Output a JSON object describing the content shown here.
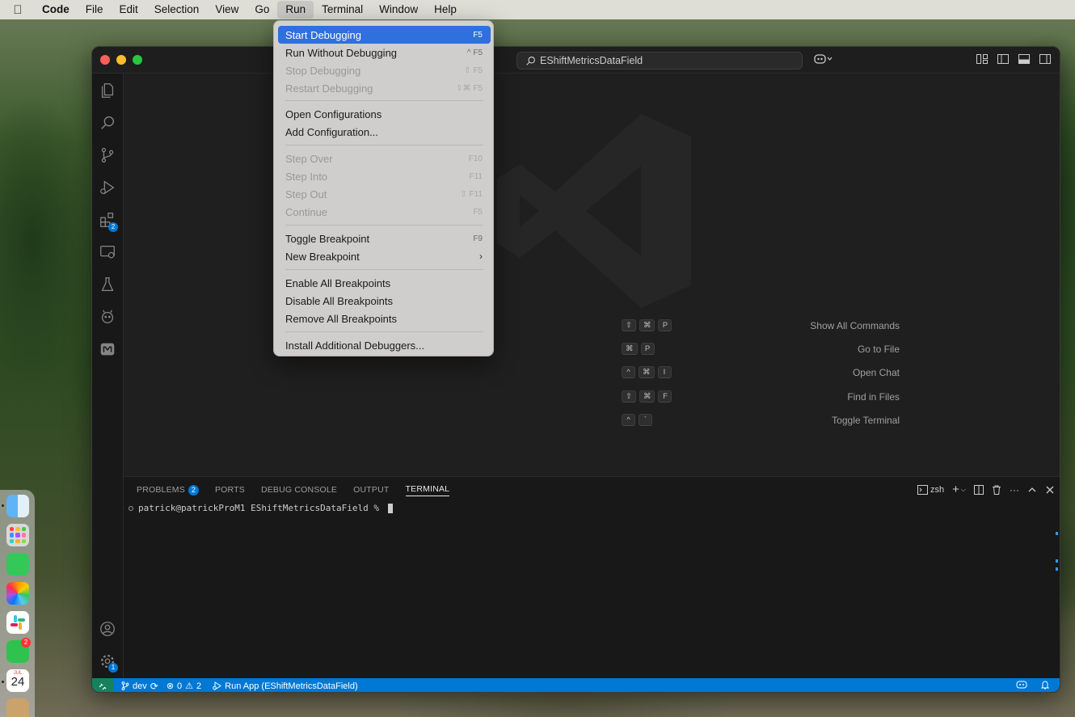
{
  "menubar": {
    "app": "Code",
    "items": [
      "File",
      "Edit",
      "Selection",
      "View",
      "Go",
      "Run",
      "Terminal",
      "Window",
      "Help"
    ],
    "active": "Run"
  },
  "window": {
    "search_text": "EShiftMetricsDataField"
  },
  "activity_bar": {
    "extensions_badge": "2",
    "settings_badge": "1"
  },
  "welcome": {
    "shortcuts": [
      {
        "label": "Show All Commands",
        "keys": [
          "⇧",
          "⌘",
          "P"
        ]
      },
      {
        "label": "Go to File",
        "keys": [
          "⌘",
          "P"
        ]
      },
      {
        "label": "Open Chat",
        "keys": [
          "^",
          "⌘",
          "I"
        ]
      },
      {
        "label": "Find in Files",
        "keys": [
          "⇧",
          "⌘",
          "F"
        ]
      },
      {
        "label": "Toggle Terminal",
        "keys": [
          "^",
          "`"
        ]
      }
    ]
  },
  "panel": {
    "tabs": [
      {
        "label": "PROBLEMS",
        "badge": "2"
      },
      {
        "label": "PORTS"
      },
      {
        "label": "DEBUG CONSOLE"
      },
      {
        "label": "OUTPUT"
      },
      {
        "label": "TERMINAL",
        "active": true
      }
    ],
    "shell_label": "zsh",
    "terminal_prompt": "patrick@patrickProM1 EShiftMetricsDataField % "
  },
  "statusbar": {
    "branch": "dev",
    "errors": "0",
    "warnings": "2",
    "run_target": "Run App (EShiftMetricsDataField)"
  },
  "run_menu": {
    "items": [
      {
        "label": "Start Debugging",
        "shortcut": "F5",
        "selected": true
      },
      {
        "label": "Run Without Debugging",
        "shortcut": "^ F5"
      },
      {
        "label": "Stop Debugging",
        "shortcut": "⇧ F5",
        "disabled": true
      },
      {
        "label": "Restart Debugging",
        "shortcut": "⇧⌘ F5",
        "disabled": true
      },
      {
        "label": "Open Configurations"
      },
      {
        "label": "Add Configuration..."
      },
      {
        "label": "Step Over",
        "shortcut": "F10",
        "disabled": true
      },
      {
        "label": "Step Into",
        "shortcut": "F11",
        "disabled": true
      },
      {
        "label": "Step Out",
        "shortcut": "⇧ F11",
        "disabled": true
      },
      {
        "label": "Continue",
        "shortcut": "F5",
        "disabled": true
      },
      {
        "label": "Toggle Breakpoint",
        "shortcut": "F9"
      },
      {
        "label": "New Breakpoint",
        "submenu": true
      },
      {
        "label": "Enable All Breakpoints"
      },
      {
        "label": "Disable All Breakpoints"
      },
      {
        "label": "Remove All Breakpoints"
      },
      {
        "label": "Install Additional Debuggers..."
      }
    ]
  },
  "dock": {
    "calendar_month": "JUL",
    "calendar_day": "24",
    "facetime_badge": "2"
  },
  "colors": {
    "accent": "#0078d4",
    "menu_selection": "#2f6fde",
    "remote_indicator": "#16825d"
  }
}
